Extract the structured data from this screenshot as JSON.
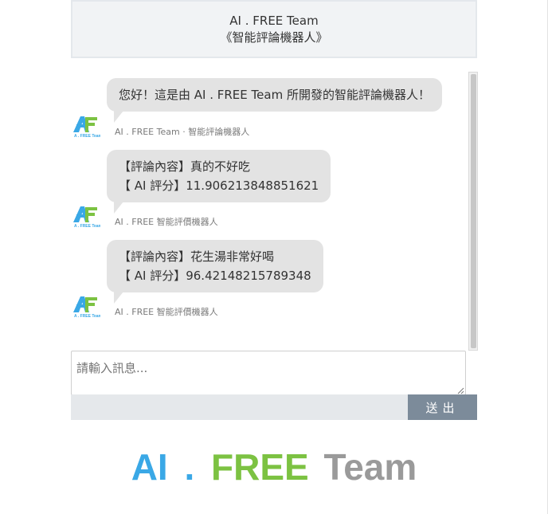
{
  "header": {
    "title": "AI . FREE Team",
    "subtitle": "《智能評論機器人》"
  },
  "messages": [
    {
      "lines": [
        "您好！這是由 AI . FREE Team 所開發的智能評論機器人！"
      ],
      "sender": "AI . FREE Team · 智能評論機器人"
    },
    {
      "lines": [
        "【評論內容】真的不好吃",
        "【 AI 評分】11.906213848851621"
      ],
      "sender": "AI . FREE 智能評價機器人"
    },
    {
      "lines": [
        "【評論內容】花生湯非常好喝",
        "【 AI 評分】96.42148215789348"
      ],
      "sender": "AI . FREE 智能評價機器人"
    }
  ],
  "avatar_text": "A . FREE Team",
  "input": {
    "placeholder": "請輸入訊息...",
    "value": ""
  },
  "send_label": "送出",
  "brand": {
    "ai": "AI",
    "dot": ".",
    "free": "FREE",
    "team": "Team"
  },
  "colors": {
    "ai_blue": "#3aa8e6",
    "free_green": "#7cc242",
    "team_gray": "#9a9a9a",
    "send_button": "#7c8b9a"
  },
  "icons": {
    "avatar": "af-logo-icon",
    "resize": "resize-grip-icon"
  }
}
